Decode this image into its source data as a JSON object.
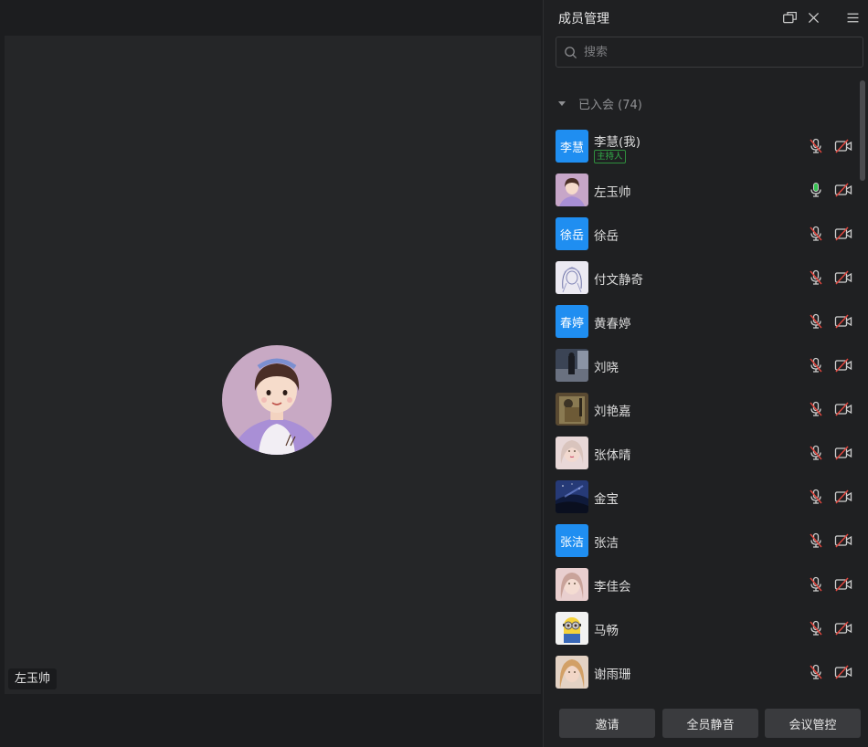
{
  "speaker": {
    "name": "左玉帅"
  },
  "panel": {
    "title": "成员管理",
    "search_placeholder": "搜索",
    "group_label": "已入会 (74)",
    "host_badge": "主持人"
  },
  "members": [
    {
      "name": "李慧(我)",
      "avatar_text": "李慧",
      "host": true,
      "mic": "muted",
      "cam": "off"
    },
    {
      "name": "左玉帅",
      "avatar_text": "",
      "avatar_image": "girl-illustration",
      "mic": "speaking",
      "cam": "off"
    },
    {
      "name": "徐岳",
      "avatar_text": "徐岳",
      "mic": "muted",
      "cam": "off"
    },
    {
      "name": "付文静奇",
      "avatar_text": "",
      "avatar_image": "sketch-girl",
      "mic": "muted",
      "cam": "off"
    },
    {
      "name": "黄春婷",
      "avatar_text": "春婷",
      "mic": "muted",
      "cam": "off"
    },
    {
      "name": "刘晓",
      "avatar_text": "",
      "avatar_image": "dark-figure-photo",
      "mic": "muted",
      "cam": "off"
    },
    {
      "name": "刘艳嘉",
      "avatar_text": "",
      "avatar_image": "soldier-photo",
      "mic": "muted",
      "cam": "off"
    },
    {
      "name": "张体晴",
      "avatar_text": "",
      "avatar_image": "woman-portrait",
      "mic": "muted",
      "cam": "off"
    },
    {
      "name": "金宝",
      "avatar_text": "",
      "avatar_image": "night-sky",
      "mic": "muted",
      "cam": "off"
    },
    {
      "name": "张洁",
      "avatar_text": "张洁",
      "mic": "muted",
      "cam": "off"
    },
    {
      "name": "李佳会",
      "avatar_text": "",
      "avatar_image": "woman-portrait-pink",
      "mic": "muted",
      "cam": "off"
    },
    {
      "name": "马畅",
      "avatar_text": "",
      "avatar_image": "minion",
      "mic": "muted",
      "cam": "off"
    },
    {
      "name": "谢雨珊",
      "avatar_text": "",
      "avatar_image": "woman-blonde",
      "mic": "muted",
      "cam": "off"
    }
  ],
  "footer": {
    "invite_label": "邀请",
    "mute_all_label": "全员静音",
    "manage_label": "会议管控"
  },
  "colors": {
    "accent_blue": "#1f8ef1",
    "muted_red": "#e0463e",
    "speaking_green": "#36c152"
  }
}
